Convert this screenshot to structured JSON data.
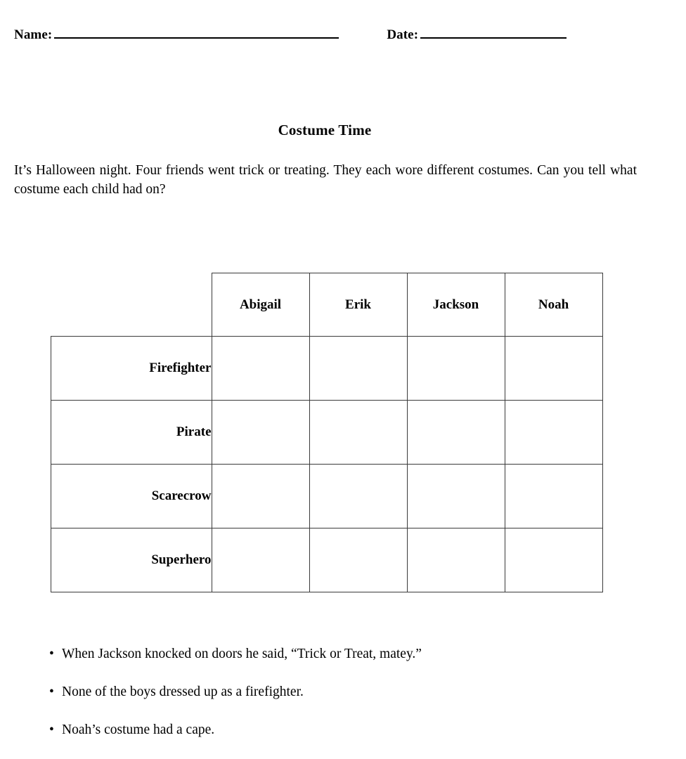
{
  "header": {
    "name_label": "Name:",
    "date_label": "Date:"
  },
  "title": "Costume Time",
  "intro": "It’s Halloween night. Four friends went trick or treating. They each wore different costumes. Can you tell what costume each child had on?",
  "grid": {
    "columns": [
      "Abigail",
      "Erik",
      "Jackson",
      "Noah"
    ],
    "rows": [
      "Firefighter",
      "Pirate",
      "Scarecrow",
      "Superhero"
    ],
    "cells": [
      [
        "",
        "",
        "",
        ""
      ],
      [
        "",
        "",
        "",
        ""
      ],
      [
        "",
        "",
        "",
        ""
      ],
      [
        "",
        "",
        "",
        ""
      ]
    ]
  },
  "clues": [
    "When Jackson knocked on doors he said, “Trick or Treat, matey.”",
    "None of the boys dressed up as a firefighter.",
    "Noah’s costume had a cape."
  ],
  "bullet_glyph": "•",
  "colors": {
    "text": "#000000",
    "grid_border": "#3a3a3a",
    "page_background": "#ffffff"
  }
}
